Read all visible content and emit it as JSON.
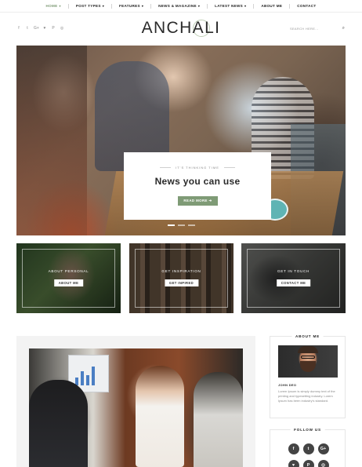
{
  "nav": {
    "items": [
      {
        "label": "HOME",
        "caret": "▾",
        "active": true
      },
      {
        "label": "POST TYPES",
        "caret": "▾",
        "active": false
      },
      {
        "label": "FEATURES",
        "caret": "▾",
        "active": false
      },
      {
        "label": "NEWS & MAGAZINE",
        "caret": "▾",
        "active": false
      },
      {
        "label": "LATEST NEWS",
        "caret": "▾",
        "active": false
      },
      {
        "label": "ABOUT ME",
        "caret": "",
        "active": false
      },
      {
        "label": "CONTACT",
        "caret": "",
        "active": false
      }
    ],
    "accent_color": "#7f9b76"
  },
  "header": {
    "social_icons": [
      {
        "name": "facebook-icon",
        "glyph": "f"
      },
      {
        "name": "twitter-icon",
        "glyph": "t"
      },
      {
        "name": "google-plus-icon",
        "glyph": "G+"
      },
      {
        "name": "heart-icon",
        "glyph": "♥"
      },
      {
        "name": "pinterest-icon",
        "glyph": "P"
      },
      {
        "name": "instagram-icon",
        "glyph": "◎"
      }
    ],
    "logo": "ANCHALI",
    "search_placeholder": "SEARCH HERE...",
    "search_icon": "⌕"
  },
  "hero": {
    "kicker": "IT'S THINKING TIME",
    "title": "News you can use",
    "button_label": "READ MORE ➔",
    "slide_count": 3,
    "active_slide": 1
  },
  "promos": [
    {
      "title": "ABOUT PERSONAL",
      "button": "ABOUT ME"
    },
    {
      "title": "GET INSPIRATION",
      "button": "GET INPIRED"
    },
    {
      "title": "GET IN TOUCH",
      "button": "CONTACT ME"
    }
  ],
  "sidebar": {
    "about": {
      "title": "ABOUT ME",
      "name": "JOHN DEO",
      "text": "Lorem Ipsum is simply dummy text of the printing and typesetting industry. Lorem Ipsum has been industry's standard."
    },
    "follow": {
      "title": "FOLLOW US",
      "row1": [
        "f",
        "t",
        "G+"
      ],
      "row2": [
        "♥",
        "P",
        "◎"
      ]
    }
  }
}
